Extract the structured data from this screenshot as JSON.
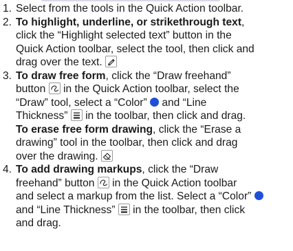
{
  "steps": [
    {
      "number": "1.",
      "lines": [
        [
          "Select from the tools in the Quick Action toolbar."
        ]
      ]
    },
    {
      "number": "2.",
      "lines": [
        [
          "To highlight, underline, or strikethrough text",
          ","
        ],
        [
          "click the “Highlight selected text” button in the"
        ],
        [
          "Quick Action toolbar, select the tool, then click and"
        ],
        [
          "drag over the text."
        ]
      ]
    },
    {
      "number": "3.",
      "lines": [
        [
          "To draw free form",
          ", click the “Draw freehand”"
        ],
        [
          "button",
          " in the Quick Action toolbar, select the"
        ],
        [
          "“Draw” tool, select a “Color”",
          " and “Line"
        ],
        [
          "Thickness”",
          " in the toolbar, then click and drag."
        ],
        [
          "To erase free form drawing",
          ", click the “Erase a"
        ],
        [
          "drawing” tool in the toolbar, then click and drag"
        ],
        [
          "over the drawing."
        ]
      ]
    },
    {
      "number": "4.",
      "lines": [
        [
          "To add drawing markups",
          ", click the “Draw"
        ],
        [
          "freehand” button",
          " in the Quick Action toolbar"
        ],
        [
          "and select a markup from the list. Select a “Color”"
        ],
        [
          "and “Line Thickness”",
          " in the toolbar, then click"
        ],
        [
          "and drag."
        ]
      ]
    }
  ],
  "icons": {
    "highlight": "highlighter-pen-icon",
    "draw_freehand": "freehand-draw-icon",
    "color": "color-dot-icon",
    "line_thickness": "line-thickness-icon",
    "erase": "eraser-icon"
  },
  "colors": {
    "text": "#1a1a1a",
    "color_swatch": "#1f4fd9",
    "icon_border": "#9a9a9a"
  }
}
